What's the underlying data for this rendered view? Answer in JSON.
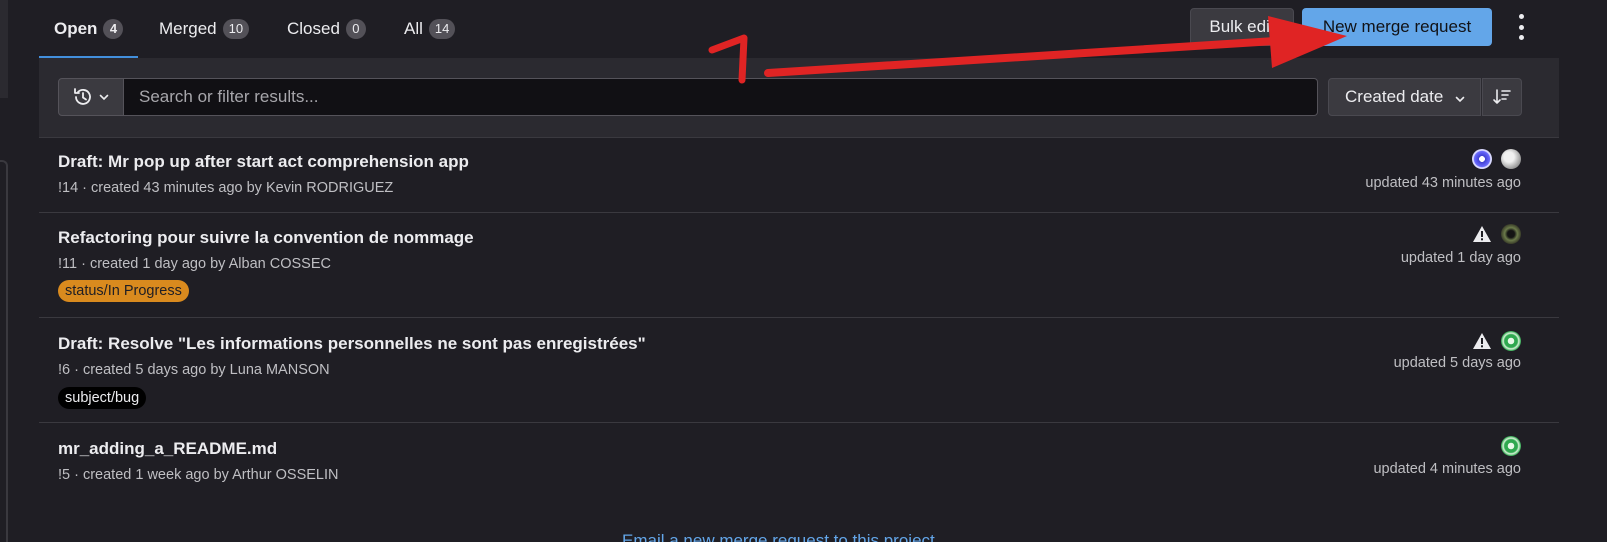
{
  "tabs": [
    {
      "label": "Open",
      "count": "4"
    },
    {
      "label": "Merged",
      "count": "10"
    },
    {
      "label": "Closed",
      "count": "0"
    },
    {
      "label": "All",
      "count": "14"
    }
  ],
  "toolbar": {
    "bulk_edit_label": "Bulk edit",
    "new_mr_label": "New merge request"
  },
  "filter": {
    "search_placeholder": "Search or filter results...",
    "sort_label": "Created date"
  },
  "merge_requests": [
    {
      "title": "Draft: Mr pop up after start act comprehension app",
      "meta": "!14 · created 43 minutes ago by Kevin RODRIGUEZ",
      "updated": "updated 43 minutes ago"
    },
    {
      "title": "Refactoring pour suivre la convention de nommage",
      "meta": "!11 · created 1 day ago by Alban COSSEC",
      "label": "status/In Progress",
      "updated": "updated 1 day ago"
    },
    {
      "title": "Draft: Resolve \"Les informations personnelles ne sont pas enregistrées\"",
      "meta": "!6 · created 5 days ago by Luna MANSON",
      "label": "subject/bug",
      "updated": "updated 5 days ago"
    },
    {
      "title": "mr_adding_a_README.md",
      "meta": "!5 · created 1 week ago by Arthur OSSELIN",
      "updated": "updated 4 minutes ago"
    }
  ],
  "footer": {
    "email_link": "Email a new merge request to this project"
  },
  "annotation": {
    "number": "1",
    "color": "#e02424"
  },
  "colors": {
    "accent": "#428fdc",
    "primary_button": "#63a6e9",
    "label_in_progress": "#d98a1e",
    "label_bug": "#000000"
  }
}
